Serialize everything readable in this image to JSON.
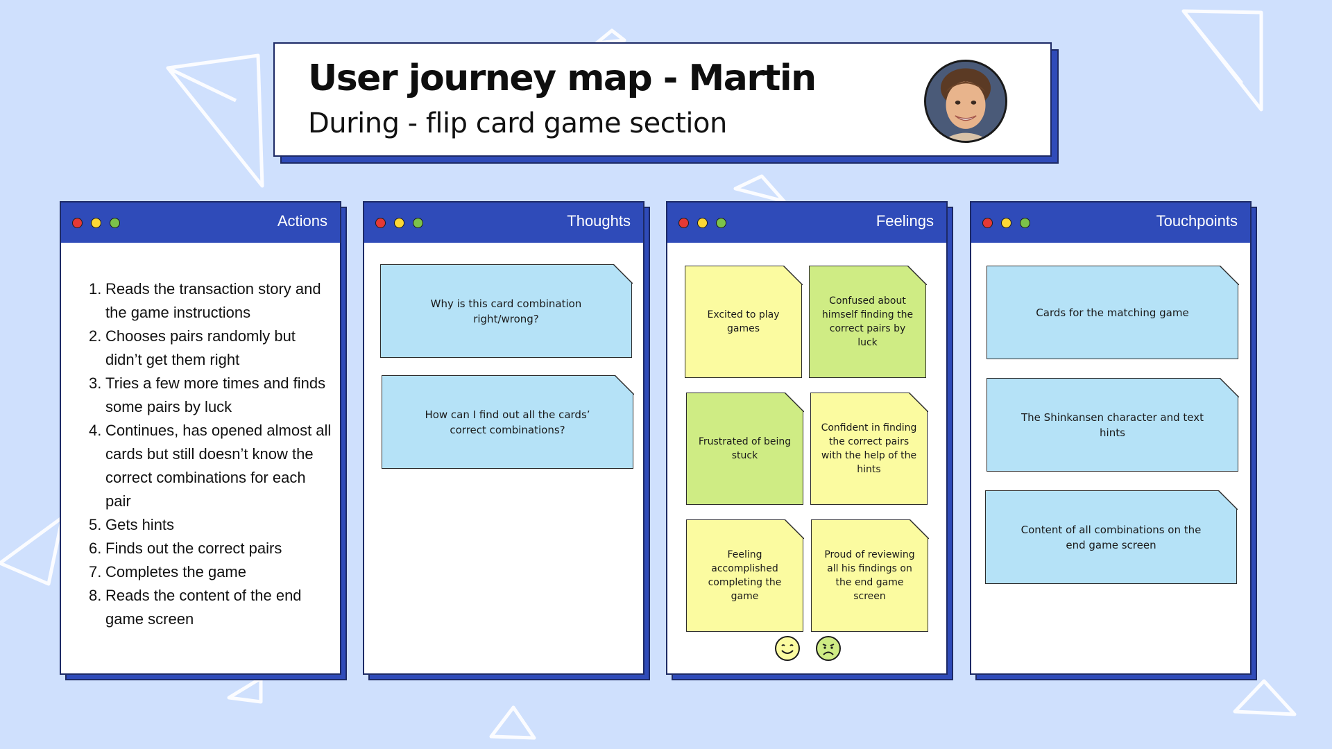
{
  "header": {
    "title": "User journey map - Martin",
    "subtitle": "During - flip card game section"
  },
  "panels": [
    {
      "title": "Actions",
      "items": [
        "Reads the transaction story and the game instructions",
        "Chooses pairs randomly but didn’t get them right",
        "Tries a few more times and finds some pairs by luck",
        "Continues, has opened almost all cards but still doesn’t know the correct combinations for each pair",
        "Gets hints",
        "Finds out the correct pairs",
        "Completes the game",
        "Reads the content of the end game screen"
      ]
    },
    {
      "title": "Thoughts",
      "notes": [
        "Why is this card combination right/wrong?",
        "How can I find out all the cards’ correct combinations?"
      ]
    },
    {
      "title": "Feelings",
      "notes": [
        {
          "text": "Excited to play games",
          "color": "#fbfba0"
        },
        {
          "text": "Confused about himself finding the correct pairs by luck",
          "color": "#cfec84"
        },
        {
          "text": "Frustrated of being stuck",
          "color": "#cfec84"
        },
        {
          "text": "Confident in finding the correct pairs with the help of the hints",
          "color": "#fbfba0"
        },
        {
          "text": "Feeling accomplished completing the game",
          "color": "#fbfba0"
        },
        {
          "text": "Proud of reviewing all his findings on the end game screen",
          "color": "#fbfba0"
        }
      ],
      "legend_icons": [
        "smiley-face-icon",
        "worried-face-icon"
      ]
    },
    {
      "title": "Touchpoints",
      "notes": [
        "Cards for the matching game",
        "The Shinkansen character and text hints",
        "Content of all combinations on the end game screen"
      ]
    }
  ],
  "colors": {
    "background": "#cfe0fd",
    "window_bar": "#2f4bb9",
    "note_blue": "#b5e2f7",
    "note_yellow": "#fbfba0",
    "note_green": "#cfec84"
  }
}
